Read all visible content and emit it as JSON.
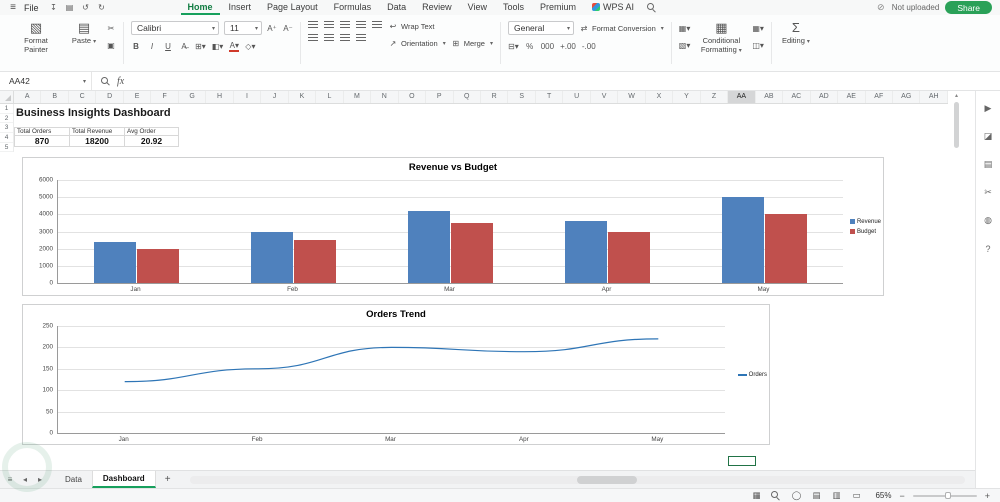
{
  "titlebar": {
    "file_menu": "File",
    "quick_icons": [
      {
        "n": "save-icon",
        "g": "↧"
      },
      {
        "n": "print-icon",
        "g": "▤"
      },
      {
        "n": "undo-icon",
        "g": "↺"
      },
      {
        "n": "redo-icon",
        "g": "↻"
      }
    ],
    "tabs": [
      "Home",
      "Insert",
      "Page Layout",
      "Formulas",
      "Data",
      "Review",
      "View",
      "Tools",
      "Premium",
      "WPS AI"
    ],
    "active_tab": "Home",
    "upload_status": "Not uploaded",
    "share_label": "Share"
  },
  "icons": {
    "hamburger": "≡",
    "offline": "⊘",
    "dropdown": "▾",
    "format_painter": "▧",
    "paste": "▤",
    "sigma": "Σ",
    "cond_format": "▦",
    "orientation": "↗",
    "wrap": "↩",
    "merge": "⊞",
    "swap": "⇄",
    "up_arrow": "▴"
  },
  "ribbon": {
    "format_painter": "Format Painter",
    "paste": "Paste",
    "clipboard_icons": [
      {
        "n": "cut-icon",
        "g": "✂"
      },
      {
        "n": "copy-icon",
        "g": "▣"
      }
    ],
    "font_name": "Calibri",
    "font_size": "11",
    "font_buttons_row1": [
      {
        "n": "increase-font-size-button",
        "g": "A⁺"
      },
      {
        "n": "decrease-font-size-button",
        "g": "A⁻"
      }
    ],
    "font_buttons_row2": [
      {
        "n": "bold-button",
        "g": "B",
        "c": "fw"
      },
      {
        "n": "italic-button",
        "g": "I",
        "c": "it"
      },
      {
        "n": "underline-button",
        "g": "U",
        "c": "un"
      },
      {
        "n": "strikethrough-button",
        "g": "A̶"
      },
      {
        "n": "borders-button",
        "g": "⊞▾"
      },
      {
        "n": "fill-color-button",
        "g": "◧▾"
      },
      {
        "n": "font-color-button",
        "g": "A▾",
        "c": "fc"
      },
      {
        "n": "phonetic-guide-button",
        "g": "◇▾"
      }
    ],
    "align_row1": [
      {
        "n": "align-top-button",
        "c": "icon-bars"
      },
      {
        "n": "align-middle-button",
        "c": "icon-bars"
      },
      {
        "n": "align-bottom-button",
        "c": "icon-bars"
      },
      {
        "n": "indent-decrease-button",
        "c": "icon-bars"
      },
      {
        "n": "indent-increase-button",
        "c": "icon-bars"
      }
    ],
    "align_row2": [
      {
        "n": "align-left-button",
        "c": "icon-bars"
      },
      {
        "n": "align-center-button",
        "c": "icon-bars"
      },
      {
        "n": "align-right-button",
        "c": "icon-bars"
      },
      {
        "n": "justify-button",
        "c": "icon-bars"
      }
    ],
    "orientation": "Orientation",
    "wrap_text": "Wrap Text",
    "merge": "Merge",
    "number_format": "General",
    "number_buttons": [
      {
        "n": "accounting-format-button",
        "g": "⊟▾"
      },
      {
        "n": "percent-format-button",
        "g": "%"
      },
      {
        "n": "comma-format-button",
        "g": "000"
      },
      {
        "n": "increase-decimal-button",
        "g": "+.00"
      },
      {
        "n": "decrease-decimal-button",
        "g": "-.00"
      }
    ],
    "format_conversion": "Format Conversion",
    "style_buttons": [
      {
        "n": "format-as-table-button",
        "g": "▦▾"
      },
      {
        "n": "cell-style-button",
        "g": "▧▾"
      }
    ],
    "conditional_formatting": "Conditional Formatting",
    "style_buttons2": [
      {
        "n": "table-style-button",
        "g": "▦▾"
      },
      {
        "n": "shape-style-button",
        "g": "◫▾"
      }
    ],
    "editing": "Editing"
  },
  "formula_bar": {
    "name_box": "AA42",
    "fx": "fx"
  },
  "grid": {
    "columns": [
      "A",
      "B",
      "C",
      "D",
      "E",
      "F",
      "G",
      "H",
      "I",
      "J",
      "K",
      "L",
      "M",
      "N",
      "O",
      "P",
      "Q",
      "R",
      "S",
      "T",
      "U",
      "V",
      "W",
      "X",
      "Y",
      "Z",
      "AA",
      "AB",
      "AC",
      "AD",
      "AE",
      "AF",
      "AG",
      "AH"
    ],
    "selected_column": "AA",
    "selected_cell": "AA42",
    "visible_rows": [
      "1",
      "2",
      "3",
      "4",
      "5"
    ],
    "title": "Business Insights Dashboard",
    "kpis": [
      {
        "label": "Total Orders",
        "value": "870"
      },
      {
        "label": "Total Revenue",
        "value": "18200"
      },
      {
        "label": "Avg Order",
        "value": "20.92"
      }
    ]
  },
  "chart_data": [
    {
      "type": "bar",
      "title": "Revenue vs Budget",
      "categories": [
        "Jan",
        "Feb",
        "Mar",
        "Apr",
        "May"
      ],
      "series": [
        {
          "name": "Revenue",
          "color": "#4f81bd",
          "values": [
            2400,
            3000,
            4200,
            3600,
            5000
          ]
        },
        {
          "name": "Budget",
          "color": "#c0504d",
          "values": [
            2000,
            2500,
            3500,
            3000,
            4000
          ]
        }
      ],
      "ylim": [
        0,
        6000
      ],
      "yticks": [
        0,
        1000,
        2000,
        3000,
        4000,
        5000,
        6000
      ],
      "grid": true,
      "legend_position": "right"
    },
    {
      "type": "line",
      "title": "Orders Trend",
      "categories": [
        "Jan",
        "Feb",
        "Mar",
        "Apr",
        "May"
      ],
      "series": [
        {
          "name": "Orders",
          "color": "#2e75b6",
          "values": [
            120,
            150,
            200,
            190,
            220
          ]
        }
      ],
      "ylim": [
        0,
        250
      ],
      "yticks": [
        0,
        50,
        100,
        150,
        200,
        250
      ],
      "grid": true,
      "legend_position": "right"
    }
  ],
  "sheet_tabs": {
    "nav_icons": [
      {
        "n": "sheet-list-icon",
        "g": "≡"
      },
      {
        "n": "prev-sheet-icon",
        "g": "◂"
      },
      {
        "n": "next-sheet-icon",
        "g": "▸"
      }
    ],
    "tabs": [
      "Data",
      "Dashboard"
    ],
    "active": "Dashboard",
    "add_label": "+"
  },
  "status_bar": {
    "icons": [
      {
        "n": "table-tools-icon",
        "g": "▦"
      },
      {
        "n": "find-icon",
        "g": "",
        "c": "mag-icon"
      },
      {
        "n": "record-macro-icon",
        "g": "◯"
      },
      {
        "n": "normal-view-icon",
        "g": "▤"
      },
      {
        "n": "page-layout-view-icon",
        "g": "▥"
      },
      {
        "n": "page-break-preview-icon",
        "g": "▭"
      }
    ],
    "zoom": "65%",
    "zoom_out": "−",
    "zoom_in": "+"
  },
  "right_panel": {
    "icons": [
      {
        "n": "pointer-select-icon",
        "g": "▶"
      },
      {
        "n": "shapes-panel-icon",
        "g": "◪"
      },
      {
        "n": "clipboard-panel-icon",
        "g": "▤"
      },
      {
        "n": "screenshot-tool-icon",
        "g": "✂"
      },
      {
        "n": "comment-panel-icon",
        "g": "◍"
      },
      {
        "n": "help-panel-icon",
        "g": "?"
      }
    ]
  }
}
